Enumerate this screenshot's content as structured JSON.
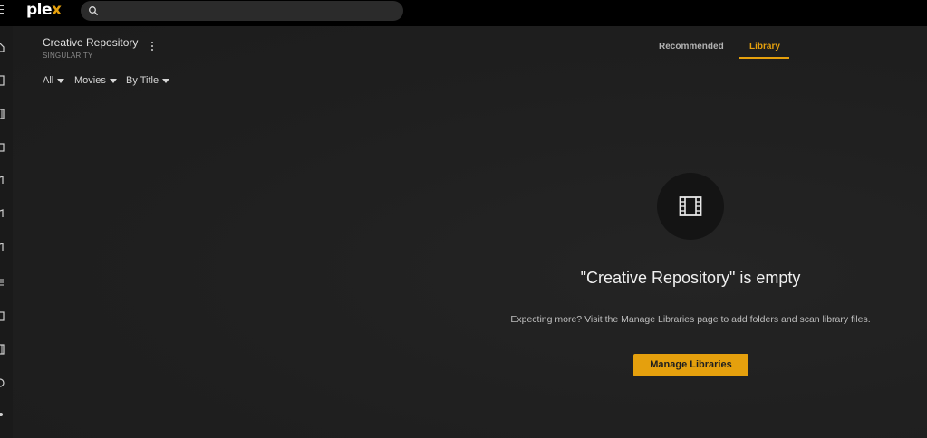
{
  "header": {
    "logo_main": "ple",
    "logo_x": "x",
    "search": {
      "value": "",
      "placeholder": ""
    }
  },
  "sidebar": {
    "icons": [
      "home-icon",
      "bookmark-icon",
      "film-icon",
      "tv-icon",
      "music-icon",
      "music-icon",
      "music-icon",
      "list-icon",
      "photo-icon",
      "film-icon",
      "clock-icon",
      "plus-icon"
    ]
  },
  "library": {
    "title": "Creative Repository",
    "server": "SINGULARITY"
  },
  "tabs": {
    "recommended": "Recommended",
    "library": "Library",
    "active": "Library"
  },
  "filters": {
    "all": "All",
    "type": "Movies",
    "sort": "By Title"
  },
  "empty_state": {
    "title": "\"Creative Repository\" is empty",
    "description": "Expecting more? Visit the Manage Libraries page to add folders and scan library files.",
    "button": "Manage Libraries"
  },
  "colors": {
    "accent": "#e5a00d",
    "background": "#1f1f1f",
    "topbar": "#000000"
  }
}
